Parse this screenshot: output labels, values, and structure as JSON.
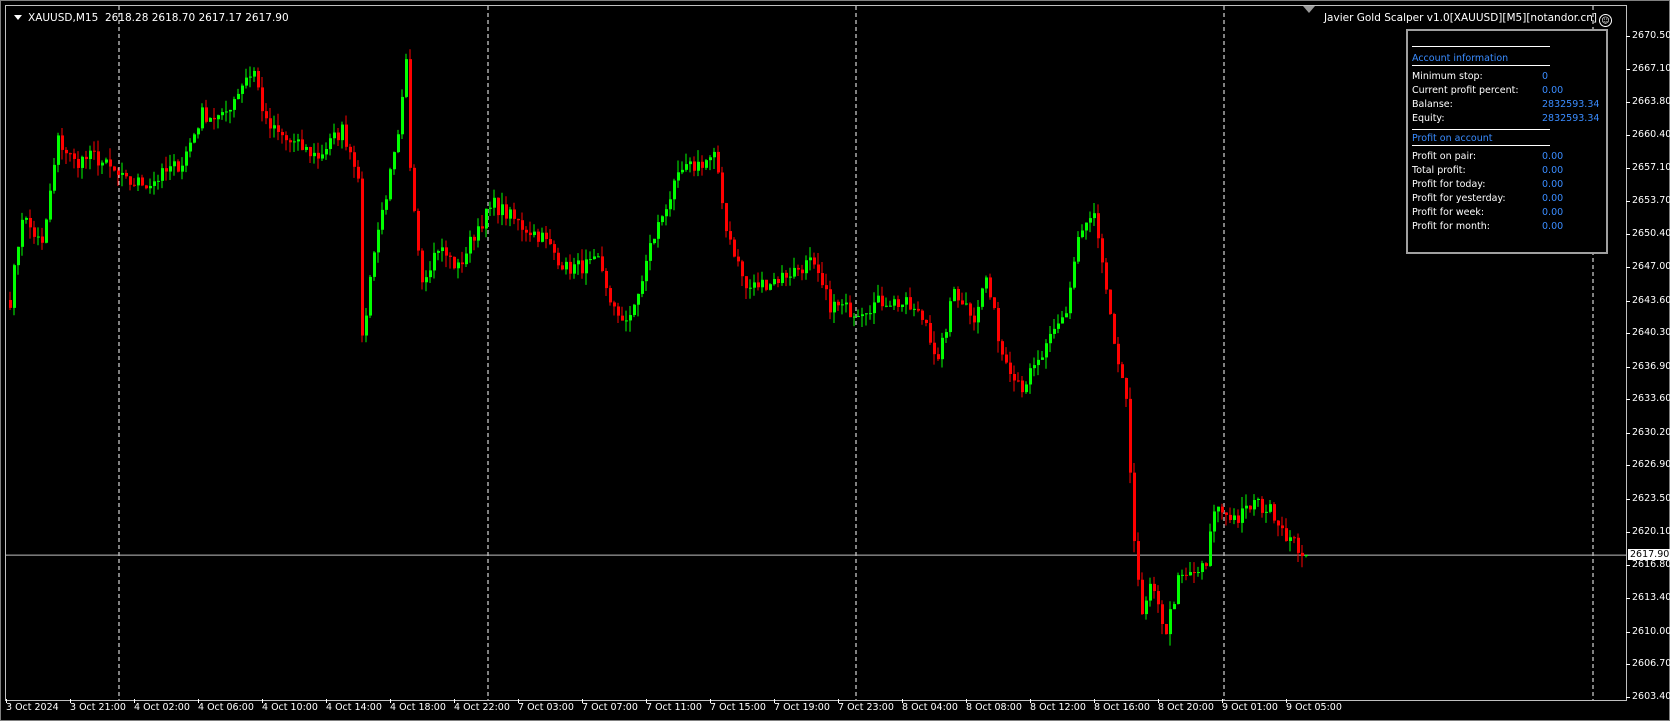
{
  "header": {
    "symbol": "XAUUSD,M15",
    "ohlc": "2618.28 2618.70 2617.17 2617.90",
    "expert": "Javier Gold Scalper v1.0[XAUUSD][M5][notandor.cn]",
    "expert_icon": "smiley-icon"
  },
  "panel": {
    "account_title": "Account information",
    "account_rows": [
      {
        "label": "Minimum stop:",
        "value": "0"
      },
      {
        "label": "Current profit percent:",
        "value": "0.00"
      },
      {
        "label": "Balanse:",
        "value": "2832593.34"
      },
      {
        "label": "Equity:",
        "value": "2832593.34"
      }
    ],
    "profit_title": "Profit on account",
    "profit_rows": [
      {
        "label": "Profit on pair:",
        "value": "0.00"
      },
      {
        "label": "Total profit:",
        "value": "0.00"
      },
      {
        "label": "Profit for today:",
        "value": "0.00"
      },
      {
        "label": "Profit for yesterday:",
        "value": "0.00"
      },
      {
        "label": "Profit for week:",
        "value": "0.00"
      },
      {
        "label": "Profit for month:",
        "value": "0.00"
      }
    ]
  },
  "price_axis": [
    "2670.50",
    "2667.10",
    "2663.80",
    "2660.40",
    "2657.10",
    "2653.70",
    "2650.40",
    "2647.00",
    "2643.60",
    "2640.30",
    "2636.90",
    "2633.60",
    "2630.20",
    "2626.90",
    "2623.50",
    "2620.10",
    "2616.80",
    "2613.40",
    "2610.00",
    "2606.70",
    "2603.40"
  ],
  "current_price": "2617.90",
  "time_axis": [
    "3 Oct 2024",
    "3 Oct 21:00",
    "4 Oct 02:00",
    "4 Oct 06:00",
    "4 Oct 10:00",
    "4 Oct 14:00",
    "4 Oct 18:00",
    "4 Oct 22:00",
    "7 Oct 03:00",
    "7 Oct 07:00",
    "7 Oct 11:00",
    "7 Oct 15:00",
    "7 Oct 19:00",
    "7 Oct 23:00",
    "8 Oct 04:00",
    "8 Oct 08:00",
    "8 Oct 12:00",
    "8 Oct 16:00",
    "8 Oct 20:00",
    "9 Oct 01:00",
    "9 Oct 05:00"
  ],
  "colors": {
    "bull": "#00ff00",
    "bear": "#ff0000",
    "grid": "#ffffff",
    "background": "#000000",
    "panel_value": "#3a8cff"
  },
  "chart_data": {
    "type": "candlestick",
    "price_range": [
      2603.4,
      2670.5
    ],
    "close_waypoints": [
      [
        0,
        2643.8
      ],
      [
        3,
        2652.4
      ],
      [
        8,
        2649.2
      ],
      [
        12,
        2660
      ],
      [
        16,
        2657.8
      ],
      [
        21,
        2658.4
      ],
      [
        29,
        2655.7
      ],
      [
        35,
        2655.7
      ],
      [
        43,
        2657.8
      ],
      [
        48,
        2662.7
      ],
      [
        53,
        2662.2
      ],
      [
        59,
        2666.5
      ],
      [
        61,
        2667
      ],
      [
        64,
        2661.6
      ],
      [
        69,
        2660
      ],
      [
        77,
        2658.4
      ],
      [
        83,
        2661.1
      ],
      [
        87,
        2656.8
      ],
      [
        88,
        2639.4
      ],
      [
        91,
        2649.2
      ],
      [
        97,
        2660
      ],
      [
        99,
        2667.6
      ],
      [
        100,
        2656.8
      ],
      [
        103,
        2646
      ],
      [
        107,
        2649.2
      ],
      [
        112,
        2647
      ],
      [
        117,
        2651.3
      ],
      [
        121,
        2653.5
      ],
      [
        128,
        2651.3
      ],
      [
        133,
        2650.2
      ],
      [
        139,
        2647
      ],
      [
        147,
        2647.5
      ],
      [
        152,
        2641.6
      ],
      [
        156,
        2642.7
      ],
      [
        160,
        2649.2
      ],
      [
        164,
        2653.5
      ],
      [
        168,
        2656.8
      ],
      [
        176,
        2658.4
      ],
      [
        179,
        2651.3
      ],
      [
        184,
        2644.9
      ],
      [
        192,
        2646
      ],
      [
        200,
        2647.6
      ],
      [
        205,
        2643.3
      ],
      [
        211,
        2642.7
      ],
      [
        219,
        2643.8
      ],
      [
        224,
        2643.3
      ],
      [
        229,
        2641.6
      ],
      [
        232,
        2637.3
      ],
      [
        236,
        2644.9
      ],
      [
        241,
        2642.2
      ],
      [
        244,
        2646
      ],
      [
        248,
        2638.4
      ],
      [
        253,
        2635.1
      ],
      [
        257,
        2637.3
      ],
      [
        264,
        2642.7
      ],
      [
        267,
        2650.2
      ],
      [
        271,
        2652.4
      ],
      [
        275,
        2641.6
      ],
      [
        279,
        2633
      ],
      [
        281,
        2620
      ],
      [
        283,
        2611.3
      ],
      [
        285,
        2614.6
      ],
      [
        289,
        2610.3
      ],
      [
        292,
        2615.2
      ],
      [
        299,
        2616.7
      ],
      [
        301,
        2622.7
      ],
      [
        307,
        2621.6
      ],
      [
        311,
        2623.2
      ],
      [
        316,
        2622.2
      ],
      [
        320,
        2619.4
      ],
      [
        324,
        2617.9
      ]
    ]
  }
}
